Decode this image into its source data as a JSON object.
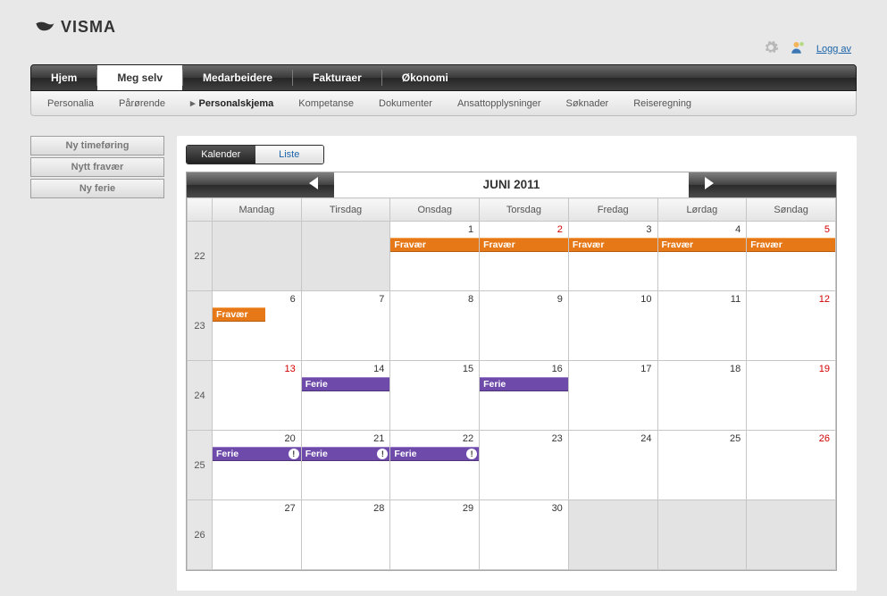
{
  "brand": "VISMA",
  "top_links": {
    "logout": "Logg av"
  },
  "nav": [
    "Hjem",
    "Meg selv",
    "Medarbeidere",
    "Fakturaer",
    "Økonomi"
  ],
  "nav_active": 1,
  "subnav": [
    "Personalia",
    "Pårørende",
    "Personalskjema",
    "Kompetanse",
    "Dokumenter",
    "Ansattopplysninger",
    "Søknader",
    "Reiseregning"
  ],
  "subnav_active": 2,
  "sidebar_buttons": [
    "Ny timeføring",
    "Nytt fravær",
    "Ny ferie"
  ],
  "view_toggle": {
    "calendar": "Kalender",
    "list": "Liste"
  },
  "calendar": {
    "title": "JUNI 2011",
    "day_headers": [
      "Mandag",
      "Tirsdag",
      "Onsdag",
      "Torsdag",
      "Fredag",
      "Lørdag",
      "Søndag"
    ],
    "event_labels": {
      "fravaer": "Fravær",
      "ferie": "Ferie"
    },
    "weeks": [
      {
        "num": "22",
        "days": [
          {
            "n": "",
            "disabled": true
          },
          {
            "n": "",
            "disabled": true
          },
          {
            "n": "1",
            "events": [
              {
                "type": "fravaer"
              }
            ]
          },
          {
            "n": "2",
            "red": true,
            "events": [
              {
                "type": "fravaer"
              }
            ]
          },
          {
            "n": "3",
            "events": [
              {
                "type": "fravaer"
              }
            ]
          },
          {
            "n": "4",
            "events": [
              {
                "type": "fravaer"
              }
            ]
          },
          {
            "n": "5",
            "red": true,
            "events": [
              {
                "type": "fravaer"
              }
            ]
          }
        ]
      },
      {
        "num": "23",
        "days": [
          {
            "n": "6",
            "events": [
              {
                "type": "fravaer",
                "half": true
              }
            ]
          },
          {
            "n": "7"
          },
          {
            "n": "8"
          },
          {
            "n": "9"
          },
          {
            "n": "10"
          },
          {
            "n": "11"
          },
          {
            "n": "12",
            "red": true
          }
        ]
      },
      {
        "num": "24",
        "days": [
          {
            "n": "13",
            "red": true
          },
          {
            "n": "14",
            "events": [
              {
                "type": "ferie"
              }
            ]
          },
          {
            "n": "15"
          },
          {
            "n": "16",
            "events": [
              {
                "type": "ferie"
              }
            ]
          },
          {
            "n": "17"
          },
          {
            "n": "18"
          },
          {
            "n": "19",
            "red": true
          }
        ]
      },
      {
        "num": "25",
        "days": [
          {
            "n": "20",
            "events": [
              {
                "type": "ferie",
                "warn": true
              }
            ]
          },
          {
            "n": "21",
            "events": [
              {
                "type": "ferie",
                "warn": true
              }
            ]
          },
          {
            "n": "22",
            "events": [
              {
                "type": "ferie",
                "warn": true
              }
            ]
          },
          {
            "n": "23"
          },
          {
            "n": "24"
          },
          {
            "n": "25"
          },
          {
            "n": "26",
            "red": true
          }
        ]
      },
      {
        "num": "26",
        "days": [
          {
            "n": "27"
          },
          {
            "n": "28"
          },
          {
            "n": "29"
          },
          {
            "n": "30"
          },
          {
            "n": "",
            "disabled": true
          },
          {
            "n": "",
            "disabled": true
          },
          {
            "n": "",
            "disabled": true
          }
        ]
      }
    ]
  }
}
